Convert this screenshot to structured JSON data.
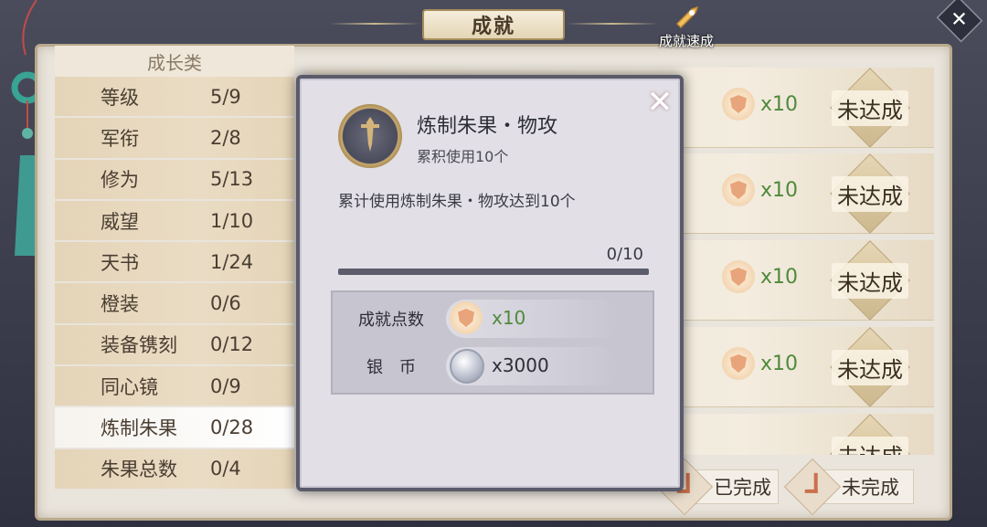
{
  "header": {
    "title": "成就",
    "quick_label": "成就速成"
  },
  "categories": {
    "header": "成长类",
    "items": [
      {
        "name": "等级",
        "count": "5/9"
      },
      {
        "name": "军衔",
        "count": "2/8"
      },
      {
        "name": "修为",
        "count": "5/13"
      },
      {
        "name": "威望",
        "count": "1/10"
      },
      {
        "name": "天书",
        "count": "1/24"
      },
      {
        "name": "橙装",
        "count": "0/6"
      },
      {
        "name": "装备镌刻",
        "count": "0/12"
      },
      {
        "name": "同心镜",
        "count": "0/9"
      },
      {
        "name": "炼制朱果",
        "count": "0/28"
      },
      {
        "name": "朱果总数",
        "count": "0/4"
      }
    ]
  },
  "achievements": [
    {
      "reward": "x10",
      "status": "未达成"
    },
    {
      "reward": "x10",
      "status": "未达成"
    },
    {
      "reward": "x10",
      "status": "未达成"
    },
    {
      "reward": "x10",
      "status": "未达成"
    },
    {
      "reward": "",
      "status": "未达成"
    }
  ],
  "filters": {
    "completed": "已完成",
    "incomplete": "未完成"
  },
  "popup": {
    "title": "炼制朱果・物攻",
    "subtitle": "累积使用10个",
    "description": "累计使用炼制朱果・物攻达到10个",
    "progress_text": "0/10",
    "progress_fraction": 0,
    "rewards": [
      {
        "label": "成就点数",
        "amount": "x10",
        "icon": "achievement-point-icon"
      },
      {
        "label": "银　币",
        "amount": "x3000",
        "icon": "silver-coin-icon"
      }
    ]
  },
  "colors": {
    "reward_green": "#4f8a3c",
    "panel_bg": "#e9e4dc",
    "popup_bg": "#e2e0e6"
  }
}
